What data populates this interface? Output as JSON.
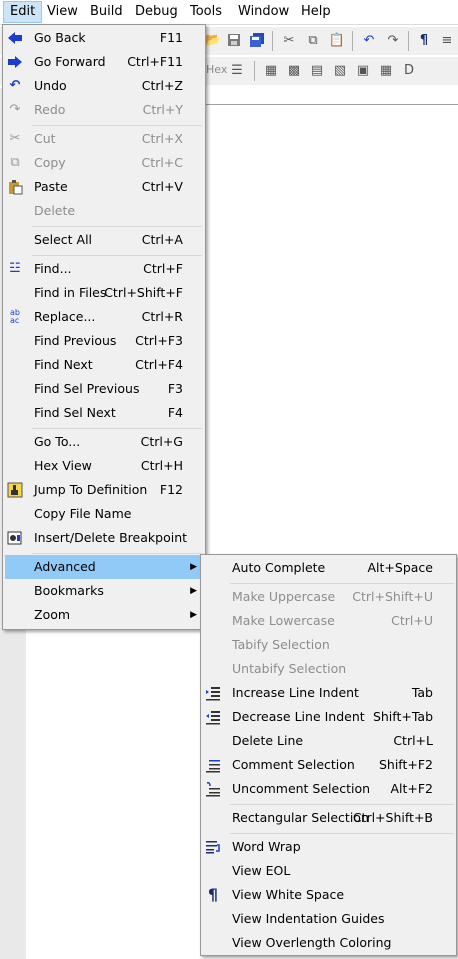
{
  "menubar": {
    "items": [
      {
        "label": "Edit"
      },
      {
        "label": "View"
      },
      {
        "label": "Build"
      },
      {
        "label": "Debug"
      },
      {
        "label": "Tools"
      },
      {
        "label": "Window"
      },
      {
        "label": "Help"
      }
    ]
  },
  "toolbar": {
    "hex_label": "Hex"
  },
  "edit_menu": {
    "go_back": {
      "label": "Go Back",
      "shortcut": "F11"
    },
    "go_forward": {
      "label": "Go Forward",
      "shortcut": "Ctrl+F11"
    },
    "undo": {
      "label": "Undo",
      "shortcut": "Ctrl+Z"
    },
    "redo": {
      "label": "Redo",
      "shortcut": "Ctrl+Y"
    },
    "cut": {
      "label": "Cut",
      "shortcut": "Ctrl+X"
    },
    "copy": {
      "label": "Copy",
      "shortcut": "Ctrl+C"
    },
    "paste": {
      "label": "Paste",
      "shortcut": "Ctrl+V"
    },
    "delete": {
      "label": "Delete",
      "shortcut": ""
    },
    "select_all": {
      "label": "Select All",
      "shortcut": "Ctrl+A"
    },
    "find": {
      "label": "Find...",
      "shortcut": "Ctrl+F"
    },
    "find_in_files": {
      "label": "Find in Files",
      "shortcut": "Ctrl+Shift+F"
    },
    "replace": {
      "label": "Replace...",
      "shortcut": "Ctrl+R"
    },
    "find_previous": {
      "label": "Find Previous",
      "shortcut": "Ctrl+F3"
    },
    "find_next": {
      "label": "Find Next",
      "shortcut": "Ctrl+F4"
    },
    "find_sel_previous": {
      "label": "Find Sel Previous",
      "shortcut": "F3"
    },
    "find_sel_next": {
      "label": "Find Sel Next",
      "shortcut": "F4"
    },
    "go_to": {
      "label": "Go To...",
      "shortcut": "Ctrl+G"
    },
    "hex_view": {
      "label": "Hex View",
      "shortcut": "Ctrl+H"
    },
    "jump_to_definition": {
      "label": "Jump To Definition",
      "shortcut": "F12"
    },
    "copy_file_name": {
      "label": "Copy File Name",
      "shortcut": ""
    },
    "toggle_breakpoint": {
      "label": "Insert/Delete Breakpoint",
      "shortcut": ""
    },
    "advanced": {
      "label": "Advanced"
    },
    "bookmarks": {
      "label": "Bookmarks"
    },
    "zoom": {
      "label": "Zoom"
    }
  },
  "advanced_menu": {
    "auto_complete": {
      "label": "Auto Complete",
      "shortcut": "Alt+Space"
    },
    "make_uppercase": {
      "label": "Make Uppercase",
      "shortcut": "Ctrl+Shift+U"
    },
    "make_lowercase": {
      "label": "Make Lowercase",
      "shortcut": "Ctrl+U"
    },
    "tabify_selection": {
      "label": "Tabify Selection",
      "shortcut": ""
    },
    "untabify_selection": {
      "label": "Untabify Selection",
      "shortcut": ""
    },
    "increase_line_indent": {
      "label": "Increase Line Indent",
      "shortcut": "Tab"
    },
    "decrease_line_indent": {
      "label": "Decrease Line Indent",
      "shortcut": "Shift+Tab"
    },
    "delete_line": {
      "label": "Delete Line",
      "shortcut": "Ctrl+L"
    },
    "comment_selection": {
      "label": "Comment Selection",
      "shortcut": "Shift+F2"
    },
    "uncomment_selection": {
      "label": "Uncomment Selection",
      "shortcut": "Alt+F2"
    },
    "rectangular_selection": {
      "label": "Rectangular Selection",
      "shortcut": "Ctrl+Shift+B"
    },
    "word_wrap": {
      "label": "Word Wrap",
      "shortcut": ""
    },
    "view_eol": {
      "label": "View EOL",
      "shortcut": ""
    },
    "view_white_space": {
      "label": "View White Space",
      "shortcut": ""
    },
    "view_indentation_guides": {
      "label": "View Indentation Guides",
      "shortcut": ""
    },
    "view_overlength_coloring": {
      "label": "View Overlength Coloring",
      "shortcut": ""
    }
  },
  "colors": {
    "menu_bg": "#f0f0f0",
    "highlight": "#91c9f7",
    "disabled_text": "#8d8d8d",
    "active_menubar": "#cce4f7",
    "icon_blue": "#1a3ccf"
  }
}
